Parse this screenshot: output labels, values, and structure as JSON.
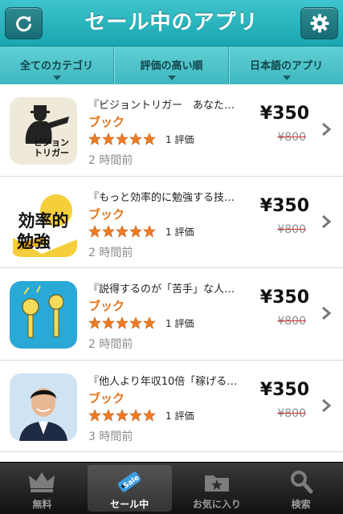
{
  "header": {
    "title": "セール中のアプリ",
    "refresh_icon": "refresh-icon",
    "settings_icon": "gear-icon",
    "bg_color": "#1fa9b3"
  },
  "filters": [
    {
      "label": "全てのカテゴリ"
    },
    {
      "label": "評価の高い順"
    },
    {
      "label": "日本語のアプリ"
    }
  ],
  "apps": [
    {
      "name": "『ビジョントリガー　あなた…",
      "category": "ブック",
      "stars": 5,
      "rating_text": "1 評価",
      "time": "2 時間前",
      "price": "¥350",
      "old_price": "¥800",
      "icon_text": "ビジョン\nトリガー"
    },
    {
      "name": "『もっと効率的に勉強する技…",
      "category": "ブック",
      "stars": 5,
      "rating_text": "1 評価",
      "time": "2 時間前",
      "price": "¥350",
      "old_price": "¥800",
      "icon_text": "効率的\n勉強"
    },
    {
      "name": "『説得するのが「苦手」な人…",
      "category": "ブック",
      "stars": 5,
      "rating_text": "1 評価",
      "time": "2 時間前",
      "price": "¥350",
      "old_price": "¥800"
    },
    {
      "name": "『他人より年収10倍「稼げる…",
      "category": "ブック",
      "stars": 5,
      "rating_text": "1 評価",
      "time": "3 時間前",
      "price": "¥350",
      "old_price": "¥800"
    }
  ],
  "tabs": [
    {
      "label": "無料",
      "icon": "crown-icon",
      "active": false
    },
    {
      "label": "セール中",
      "icon": "sale-tag-icon",
      "active": true
    },
    {
      "label": "お気に入り",
      "icon": "star-folder-icon",
      "active": false
    },
    {
      "label": "検索",
      "icon": "search-icon",
      "active": false
    }
  ]
}
